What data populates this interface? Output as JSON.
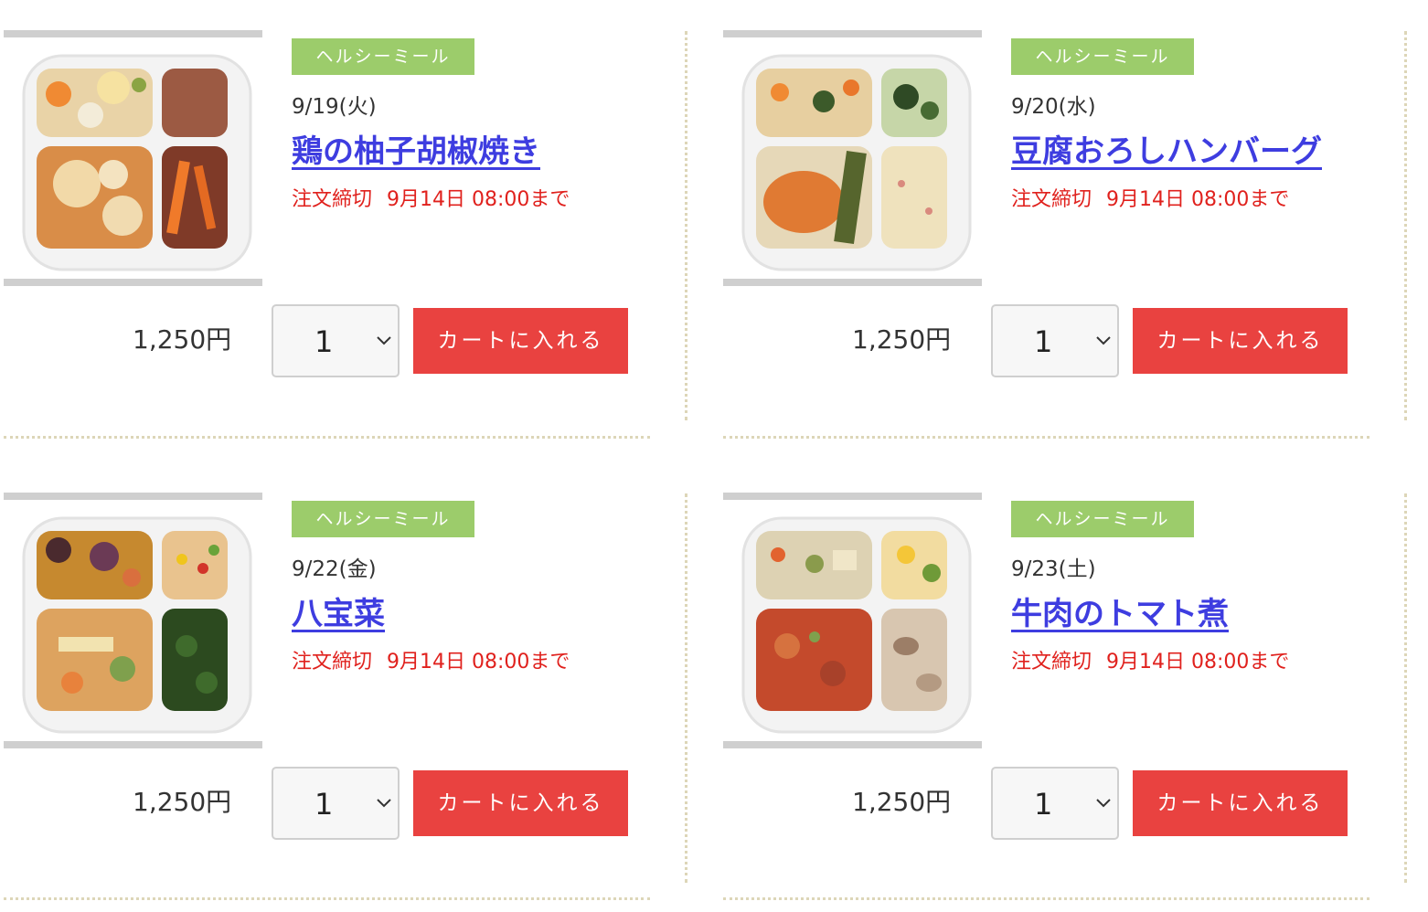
{
  "products": [
    {
      "badge": "ヘルシーミール",
      "date": "9/19(火)",
      "name": "鶏の柚子胡椒焼き",
      "deadline_label": "注文締切",
      "deadline_value": "9月14日 08:00まで",
      "price": "1,250円",
      "quantity": "1",
      "cart_label": "カートに入れる"
    },
    {
      "badge": "ヘルシーミール",
      "date": "9/20(水)",
      "name": "豆腐おろしハンバーグ",
      "deadline_label": "注文締切",
      "deadline_value": "9月14日 08:00まで",
      "price": "1,250円",
      "quantity": "1",
      "cart_label": "カートに入れる"
    },
    {
      "badge": "ヘルシーミール",
      "date": "9/22(金)",
      "name": "八宝菜",
      "deadline_label": "注文締切",
      "deadline_value": "9月14日 08:00まで",
      "price": "1,250円",
      "quantity": "1",
      "cart_label": "カートに入れる"
    },
    {
      "badge": "ヘルシーミール",
      "date": "9/23(土)",
      "name": "牛肉のトマト煮",
      "deadline_label": "注文締切",
      "deadline_value": "9月14日 08:00まで",
      "price": "1,250円",
      "quantity": "1",
      "cart_label": "カートに入れる"
    }
  ],
  "colors": {
    "badge": "#9ccc6b",
    "title_link": "#3e3de0",
    "deadline": "#e0211d",
    "cart_button": "#e94240"
  },
  "icons": {
    "quantity_dropdown": "chevron-down-icon"
  }
}
